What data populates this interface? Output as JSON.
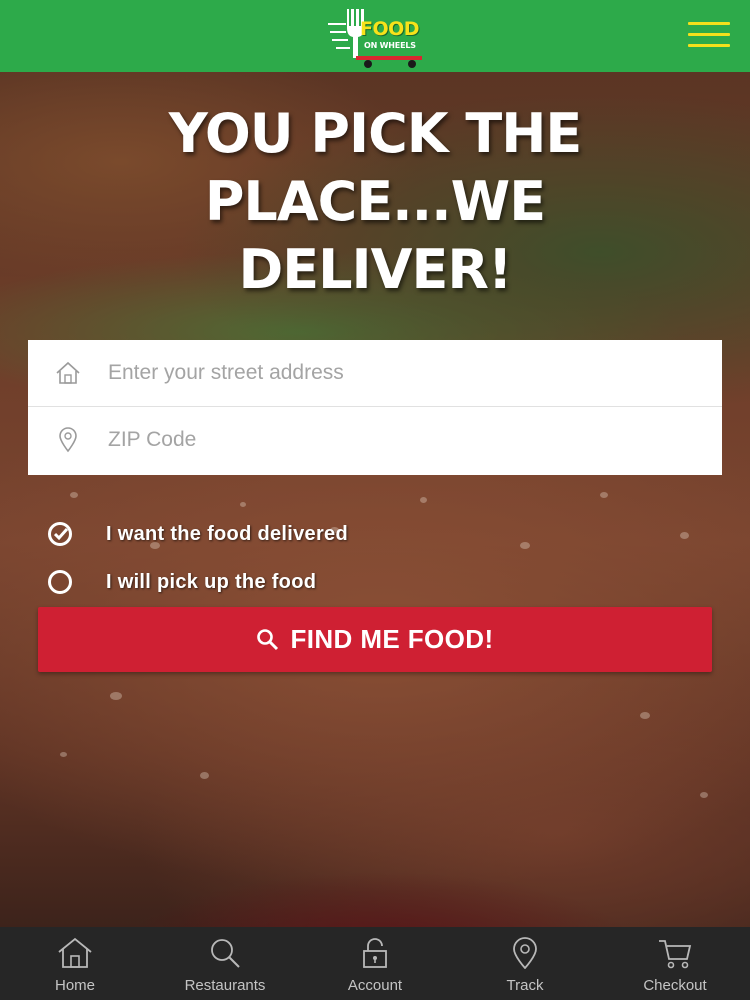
{
  "header": {
    "logo_line1": "FOOD",
    "logo_line2": "ON WHEELS",
    "menu_icon": "hamburger-menu-icon",
    "brand_color": "#2daa4a",
    "accent_color": "#f4e01c"
  },
  "hero": {
    "headline_line1": "YOU PICK THE",
    "headline_line2": "PLACE...WE",
    "headline_line3": "DELIVER!"
  },
  "form": {
    "address_placeholder": "Enter your street address",
    "address_value": "",
    "zip_placeholder": "ZIP Code",
    "zip_value": "",
    "address_icon": "home-icon",
    "zip_icon": "location-pin-icon"
  },
  "options": {
    "delivered_label": "I want the food delivered",
    "delivered_selected": true,
    "pickup_label": "I will pick up the food",
    "pickup_selected": false
  },
  "cta": {
    "label": "FIND ME FOOD!",
    "icon": "search-icon",
    "color": "#cf2033"
  },
  "bottom_nav": {
    "items": [
      {
        "label": "Home",
        "icon": "home-icon"
      },
      {
        "label": "Restaurants",
        "icon": "search-icon"
      },
      {
        "label": "Account",
        "icon": "lock-icon"
      },
      {
        "label": "Track",
        "icon": "location-pin-icon"
      },
      {
        "label": "Checkout",
        "icon": "cart-icon"
      }
    ]
  }
}
